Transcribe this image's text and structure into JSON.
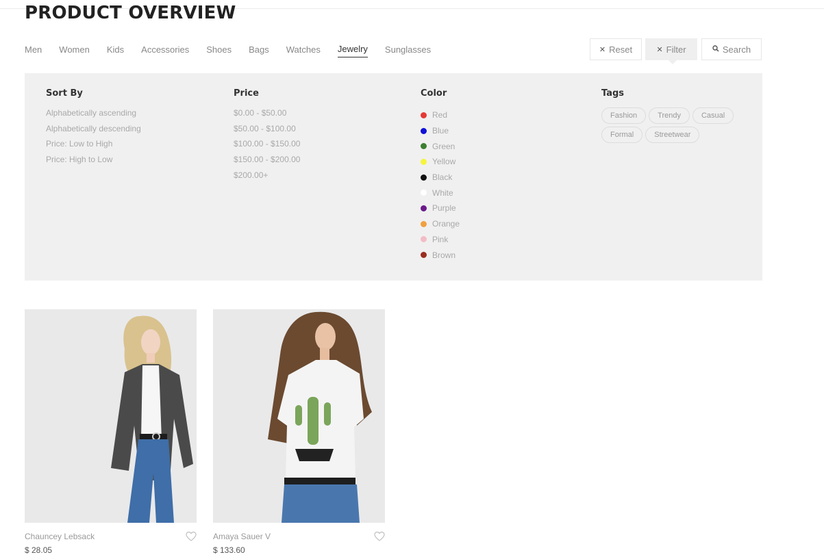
{
  "page": {
    "title": "PRODUCT OVERVIEW"
  },
  "categories": [
    {
      "label": "Men",
      "active": false
    },
    {
      "label": "Women",
      "active": false
    },
    {
      "label": "Kids",
      "active": false
    },
    {
      "label": "Accessories",
      "active": false
    },
    {
      "label": "Shoes",
      "active": false
    },
    {
      "label": "Bags",
      "active": false
    },
    {
      "label": "Watches",
      "active": false
    },
    {
      "label": "Jewelry",
      "active": true
    },
    {
      "label": "Sunglasses",
      "active": false
    }
  ],
  "actions": {
    "reset": {
      "label": "Reset",
      "icon": "close-icon"
    },
    "filter": {
      "label": "Filter",
      "icon": "close-icon"
    },
    "search": {
      "label": "Search",
      "icon": "search-icon"
    }
  },
  "filters": {
    "sort": {
      "title": "Sort By",
      "options": [
        "Alphabetically ascending",
        "Alphabetically descending",
        "Price: Low to High",
        "Price: High to Low"
      ]
    },
    "price": {
      "title": "Price",
      "options": [
        "$0.00 - $50.00",
        "$50.00 - $100.00",
        "$100.00 - $150.00",
        "$150.00 - $200.00",
        "$200.00+"
      ]
    },
    "color": {
      "title": "Color",
      "options": [
        {
          "label": "Red",
          "color": "#e53935"
        },
        {
          "label": "Blue",
          "color": "#1010d8"
        },
        {
          "label": "Green",
          "color": "#3b7f2f"
        },
        {
          "label": "Yellow",
          "color": "#f5f53c"
        },
        {
          "label": "Black",
          "color": "#111111"
        },
        {
          "label": "White",
          "color": "#ffffff"
        },
        {
          "label": "Purple",
          "color": "#6b1a8a"
        },
        {
          "label": "Orange",
          "color": "#f0a040"
        },
        {
          "label": "Pink",
          "color": "#f3bcc6"
        },
        {
          "label": "Brown",
          "color": "#9a2e22"
        }
      ]
    },
    "tags": {
      "title": "Tags",
      "items": [
        "Fashion",
        "Trendy",
        "Casual",
        "Formal",
        "Streetwear"
      ]
    }
  },
  "products": [
    {
      "name": "Chauncey Lebsack",
      "price": "$ 28.05"
    },
    {
      "name": "Amaya Sauer V",
      "price": "$ 133.60"
    }
  ]
}
